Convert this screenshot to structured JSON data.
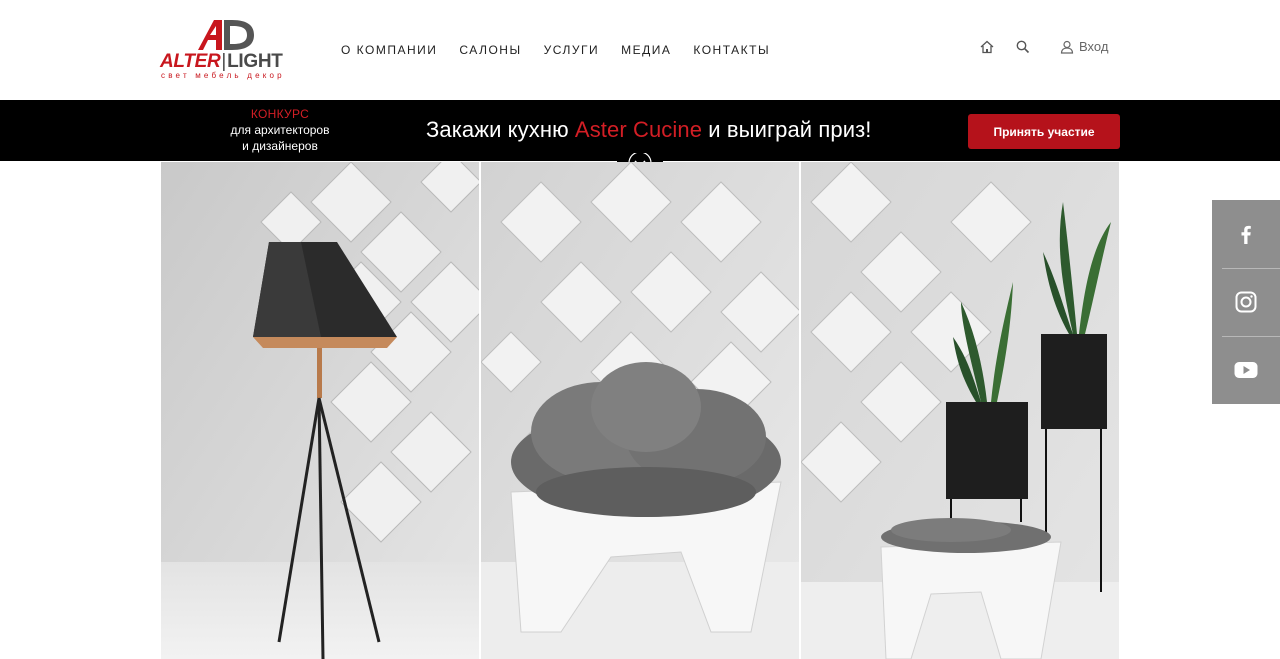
{
  "logo": {
    "name_left": "ALTER",
    "name_right": "LIGHT",
    "tagline": "свет мебель декор",
    "mark_icon": "al-monogram-icon"
  },
  "nav": {
    "items": [
      "О КОМПАНИИ",
      "САЛОНЫ",
      "УСЛУГИ",
      "МЕДИА",
      "КОНТАКТЫ"
    ]
  },
  "header": {
    "home_icon": "home-icon",
    "search_icon": "search-icon",
    "user_icon": "user-icon",
    "login_label": "Вход"
  },
  "banner": {
    "contest_title": "КОНКУРС",
    "contest_line1": "для архитекторов",
    "contest_line2": "и дизайнеров",
    "promo_before": "Закажи кухню ",
    "promo_brand": "Aster Cucine",
    "promo_after": " и выиграй приз!",
    "cta_label": "Принять участие",
    "down_icon": "chevron-down-circle-icon"
  },
  "gallery": {
    "panels": [
      "floor-lamp-image",
      "lounge-chair-image",
      "ottoman-plants-image"
    ]
  },
  "social": {
    "items": [
      "facebook-icon",
      "instagram-icon",
      "youtube-icon"
    ]
  },
  "colors": {
    "brand_red": "#c8161d",
    "cta_red": "#b5121b",
    "banner_bg": "#000000",
    "social_bg": "#8e8e8e"
  }
}
